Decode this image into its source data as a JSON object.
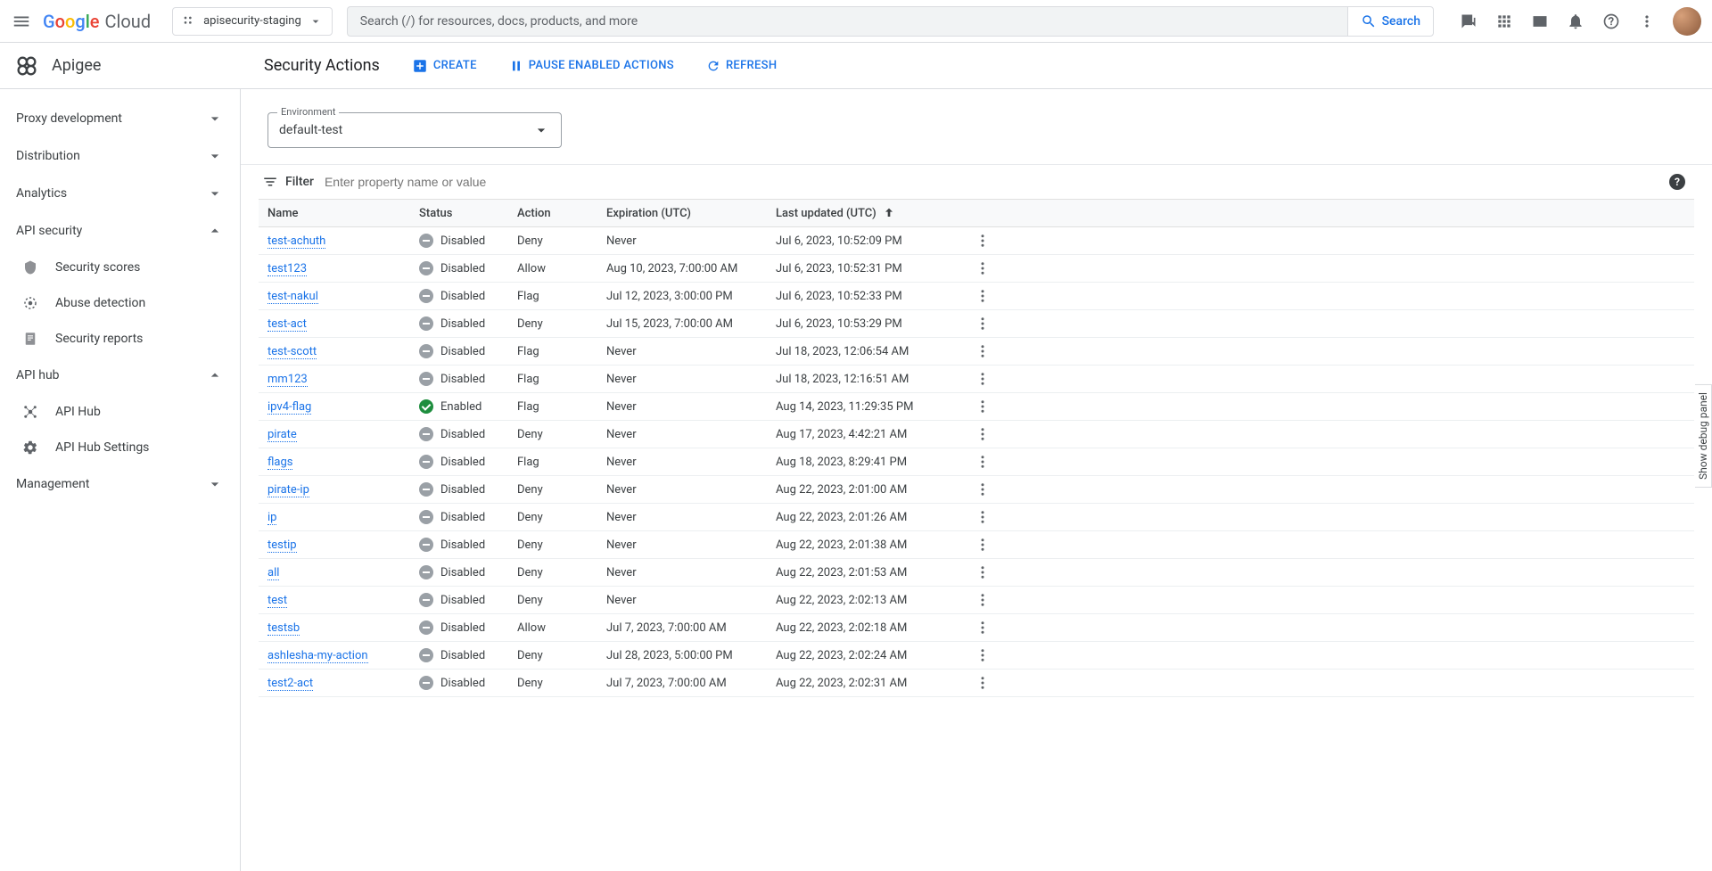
{
  "header": {
    "logo_cloud": "Cloud",
    "project": "apisecurity-staging",
    "search_placeholder": "Search (/) for resources, docs, products, and more",
    "search_button": "Search"
  },
  "product": {
    "name": "Apigee",
    "page_title": "Security Actions",
    "create": "CREATE",
    "pause": "PAUSE ENABLED ACTIONS",
    "refresh": "REFRESH"
  },
  "sidebar": {
    "sections": [
      {
        "label": "Proxy development",
        "expanded": false
      },
      {
        "label": "Distribution",
        "expanded": false
      },
      {
        "label": "Analytics",
        "expanded": false
      },
      {
        "label": "API security",
        "expanded": true,
        "items": [
          {
            "label": "Security scores",
            "icon": "shield"
          },
          {
            "label": "Abuse detection",
            "icon": "target"
          },
          {
            "label": "Security reports",
            "icon": "doc"
          }
        ]
      },
      {
        "label": "API hub",
        "expanded": true,
        "items": [
          {
            "label": "API Hub",
            "icon": "hub"
          },
          {
            "label": "API Hub Settings",
            "icon": "gear"
          }
        ]
      },
      {
        "label": "Management",
        "expanded": false
      }
    ]
  },
  "env": {
    "label": "Environment",
    "value": "default-test"
  },
  "filter": {
    "label": "Filter",
    "placeholder": "Enter property name or value"
  },
  "table": {
    "headers": {
      "name": "Name",
      "status": "Status",
      "action": "Action",
      "expiration": "Expiration (UTC)",
      "updated": "Last updated (UTC)"
    },
    "rows": [
      {
        "name": "test-achuth",
        "status": "Disabled",
        "action": "Deny",
        "exp": "Never",
        "upd": "Jul 6, 2023, 10:52:09 PM"
      },
      {
        "name": "test123",
        "status": "Disabled",
        "action": "Allow",
        "exp": "Aug 10, 2023, 7:00:00 AM",
        "upd": "Jul 6, 2023, 10:52:31 PM"
      },
      {
        "name": "test-nakul",
        "status": "Disabled",
        "action": "Flag",
        "exp": "Jul 12, 2023, 3:00:00 PM",
        "upd": "Jul 6, 2023, 10:52:33 PM"
      },
      {
        "name": "test-act",
        "status": "Disabled",
        "action": "Deny",
        "exp": "Jul 15, 2023, 7:00:00 AM",
        "upd": "Jul 6, 2023, 10:53:29 PM"
      },
      {
        "name": "test-scott",
        "status": "Disabled",
        "action": "Flag",
        "exp": "Never",
        "upd": "Jul 18, 2023, 12:06:54 AM"
      },
      {
        "name": "mm123",
        "status": "Disabled",
        "action": "Flag",
        "exp": "Never",
        "upd": "Jul 18, 2023, 12:16:51 AM"
      },
      {
        "name": "ipv4-flag",
        "status": "Enabled",
        "action": "Flag",
        "exp": "Never",
        "upd": "Aug 14, 2023, 11:29:35 PM"
      },
      {
        "name": "pirate",
        "status": "Disabled",
        "action": "Deny",
        "exp": "Never",
        "upd": "Aug 17, 2023, 4:42:21 AM"
      },
      {
        "name": "flags",
        "status": "Disabled",
        "action": "Flag",
        "exp": "Never",
        "upd": "Aug 18, 2023, 8:29:41 PM"
      },
      {
        "name": "pirate-ip",
        "status": "Disabled",
        "action": "Deny",
        "exp": "Never",
        "upd": "Aug 22, 2023, 2:01:00 AM"
      },
      {
        "name": "ip",
        "status": "Disabled",
        "action": "Deny",
        "exp": "Never",
        "upd": "Aug 22, 2023, 2:01:26 AM"
      },
      {
        "name": "testip",
        "status": "Disabled",
        "action": "Deny",
        "exp": "Never",
        "upd": "Aug 22, 2023, 2:01:38 AM"
      },
      {
        "name": "all",
        "status": "Disabled",
        "action": "Deny",
        "exp": "Never",
        "upd": "Aug 22, 2023, 2:01:53 AM"
      },
      {
        "name": "test",
        "status": "Disabled",
        "action": "Deny",
        "exp": "Never",
        "upd": "Aug 22, 2023, 2:02:13 AM"
      },
      {
        "name": "testsb",
        "status": "Disabled",
        "action": "Allow",
        "exp": "Jul 7, 2023, 7:00:00 AM",
        "upd": "Aug 22, 2023, 2:02:18 AM"
      },
      {
        "name": "ashlesha-my-action",
        "status": "Disabled",
        "action": "Deny",
        "exp": "Jul 28, 2023, 5:00:00 PM",
        "upd": "Aug 22, 2023, 2:02:24 AM"
      },
      {
        "name": "test2-act",
        "status": "Disabled",
        "action": "Deny",
        "exp": "Jul 7, 2023, 7:00:00 AM",
        "upd": "Aug 22, 2023, 2:02:31 AM"
      }
    ]
  },
  "debug_panel": "Show debug panel"
}
